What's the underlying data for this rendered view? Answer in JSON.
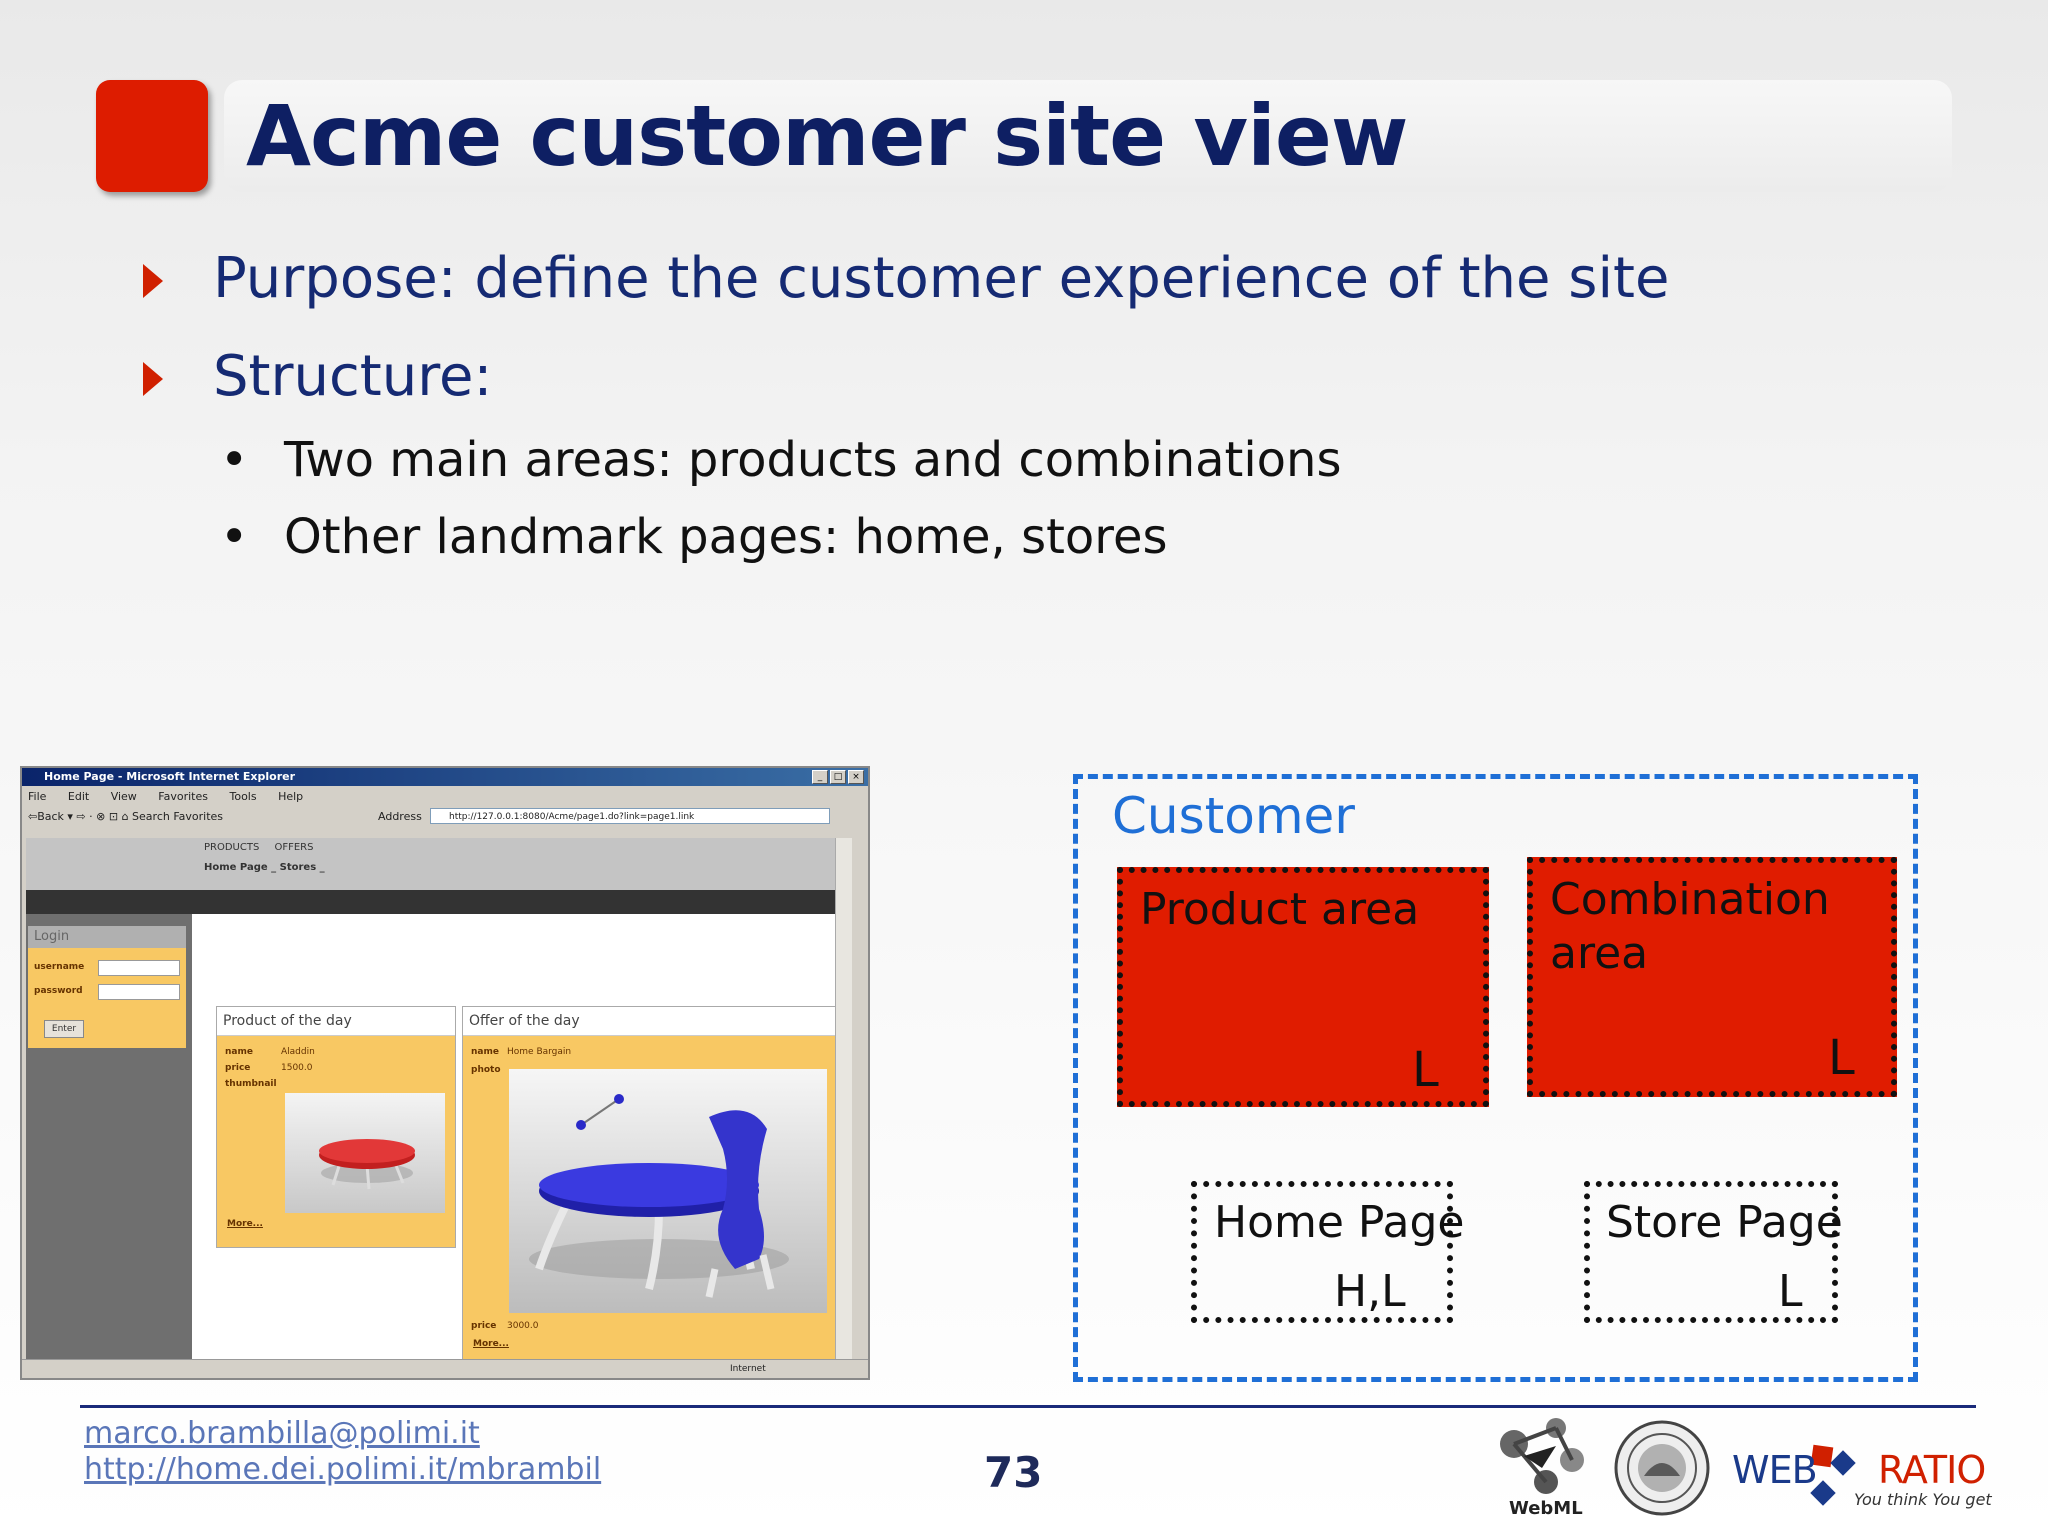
{
  "slide": {
    "title": "Acme customer site view",
    "bullets": [
      {
        "text": "Purpose: define the customer experience of the site"
      },
      {
        "text": "Structure:"
      }
    ],
    "sub_bullets": [
      {
        "text": "Two main areas: products and combinations"
      },
      {
        "text": "Other landmark pages: home, stores"
      }
    ]
  },
  "browser": {
    "window_title": "Home Page - Microsoft Internet Explorer",
    "menu": "File Edit View Favorites Tools Help",
    "toolbar": "⇦Back ▾ ⇨ · ⊗ ⊡ ⌂  Search  Favorites",
    "address_label": "Address",
    "address_value": "http://127.0.0.1:8080/Acme/page1.do?link=page1.link",
    "nav_top": "PRODUCTS OFFERS",
    "nav_bottom": "Home Page _ Stores _",
    "login": {
      "header": "Login",
      "username_label": "username",
      "password_label": "password",
      "enter_label": "Enter"
    },
    "product_card": {
      "header": "Product of the day",
      "name_label": "name",
      "name_value": "Aladdin",
      "price_label": "price",
      "price_value": "1500.0",
      "thumbnail_label": "thumbnail",
      "more": "More..."
    },
    "offer_card": {
      "header": "Offer of the day",
      "name_label": "name",
      "name_value": "Home Bargain",
      "photo_label": "photo",
      "price_label": "price",
      "price_value": "3000.0",
      "more": "More..."
    },
    "status": "Internet"
  },
  "diagram": {
    "frame_label": "Customer",
    "areas": [
      {
        "label_line1": "Product area",
        "label_line2": "",
        "marker": "L"
      },
      {
        "label_line1": "Combination",
        "label_line2": "area",
        "marker": "L"
      }
    ],
    "pages": [
      {
        "label": "Home Page",
        "marker": "H,L"
      },
      {
        "label": "Store Page",
        "marker": "L"
      }
    ]
  },
  "footer": {
    "email": "marco.brambilla@polimi.it",
    "url": "http://home.dei.polimi.it/mbrambil",
    "page_number": "73",
    "webml_label": "WebML",
    "webratio_web": "WEB",
    "webratio_ratio": "RATIO",
    "webratio_tagline": "You think You get"
  },
  "colors": {
    "title_text": "#0e1f63",
    "accent_red": "#dd1c00",
    "customer_blue": "#1f6fd6",
    "area_red": "#e01c00"
  }
}
